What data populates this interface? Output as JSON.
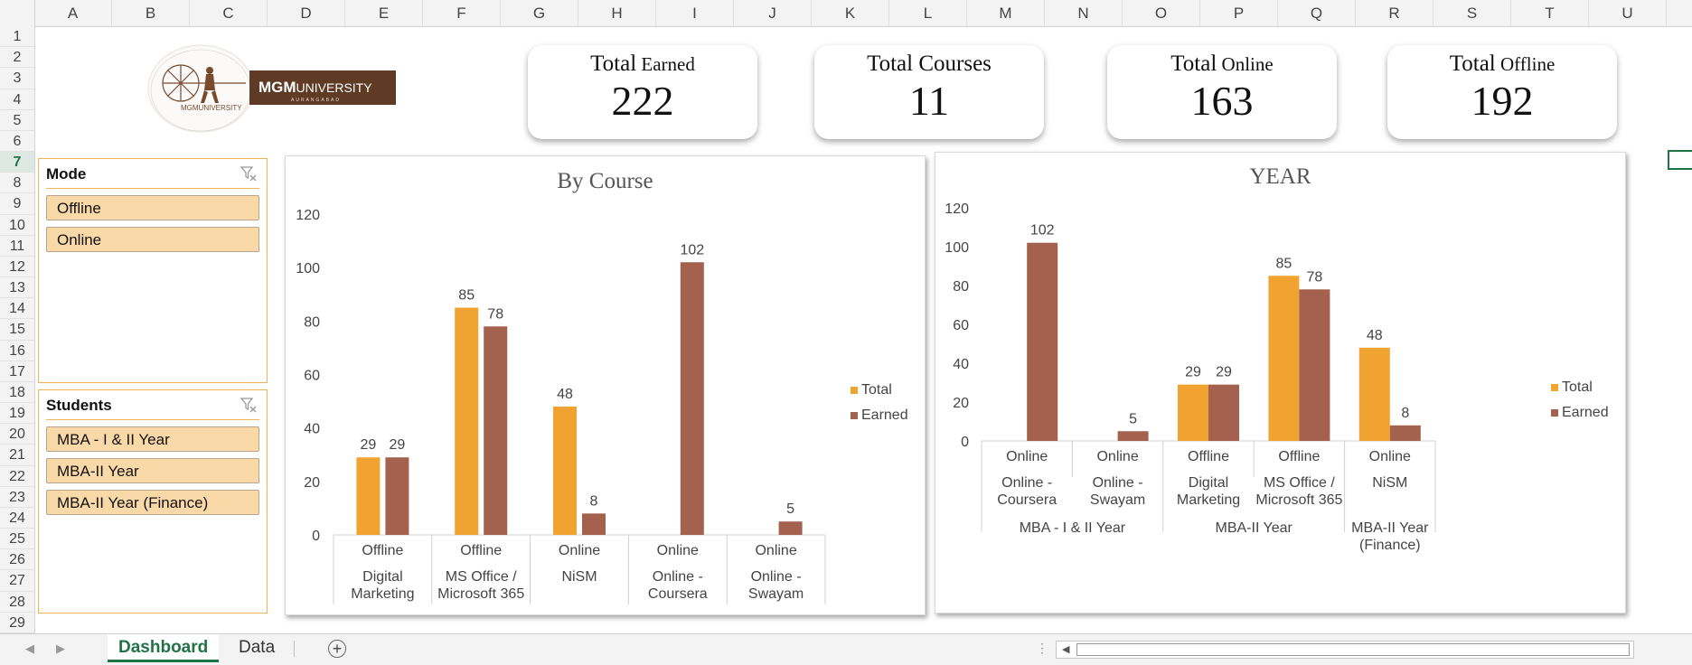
{
  "spreadsheet": {
    "columns": [
      "A",
      "B",
      "C",
      "D",
      "E",
      "F",
      "G",
      "H",
      "I",
      "J",
      "K",
      "L",
      "M",
      "N",
      "O",
      "P",
      "Q",
      "R",
      "S",
      "T",
      "U"
    ],
    "rows": [
      "1",
      "2",
      "3",
      "4",
      "5",
      "6",
      "7",
      "8",
      "9",
      "10",
      "11",
      "12",
      "13",
      "14",
      "15",
      "16",
      "17",
      "18",
      "19",
      "20",
      "21",
      "22",
      "23",
      "24",
      "25",
      "26",
      "27",
      "28",
      "29"
    ],
    "active_row": "7"
  },
  "logo": {
    "brand_bold": "MGM",
    "brand_rest": "UNIVERSITY",
    "city": "AURANGABAD",
    "seal_text": "MGMUNIVERSITY"
  },
  "kpis": [
    {
      "title_main": "Total",
      "title_rest": " Earned",
      "value": "222"
    },
    {
      "title_main": "Total Courses",
      "title_rest": "",
      "value": "11"
    },
    {
      "title_main": "Total",
      "title_rest": " Online",
      "value": "163"
    },
    {
      "title_main": "Total",
      "title_rest": " Offline",
      "value": "192"
    }
  ],
  "slicers": {
    "mode": {
      "title": "Mode",
      "items": [
        "Offline",
        "Online"
      ]
    },
    "students": {
      "title": "Students",
      "items": [
        "MBA - I & II Year",
        "MBA-II Year",
        "MBA-II Year (Finance)"
      ]
    }
  },
  "colors": {
    "total": "#f0a330",
    "earned": "#a3614e",
    "accent": "#217346"
  },
  "chart_data": [
    {
      "type": "bar",
      "title": "By Course",
      "categories": [
        {
          "mode": "Offline",
          "course": [
            "Digital",
            "Marketing"
          ]
        },
        {
          "mode": "Offline",
          "course": [
            "MS Office /",
            "Microsoft 365"
          ]
        },
        {
          "mode": "Online",
          "course": [
            "NiSM"
          ]
        },
        {
          "mode": "Online",
          "course": [
            "Online -",
            "Coursera"
          ]
        },
        {
          "mode": "Online",
          "course": [
            "Online -",
            "Swayam"
          ]
        }
      ],
      "series": [
        {
          "name": "Total",
          "values": [
            29,
            85,
            48,
            null,
            null
          ]
        },
        {
          "name": "Earned",
          "values": [
            29,
            78,
            8,
            102,
            5
          ]
        }
      ],
      "ylim": [
        0,
        120
      ],
      "yticks": [
        0,
        20,
        40,
        60,
        80,
        100,
        120
      ],
      "legend": "right",
      "grid": false
    },
    {
      "type": "bar",
      "title": "YEAR",
      "categories": [
        {
          "mode": "Online",
          "course": [
            "Online -",
            "Coursera"
          ]
        },
        {
          "mode": "Online",
          "course": [
            "Online -",
            "Swayam"
          ]
        },
        {
          "mode": "Offline",
          "course": [
            "Digital",
            "Marketing"
          ]
        },
        {
          "mode": "Offline",
          "course": [
            "MS Office /",
            "Microsoft 365"
          ]
        },
        {
          "mode": "Online",
          "course": [
            "NiSM"
          ]
        }
      ],
      "groups": [
        {
          "label": [
            "MBA - I & II Year"
          ],
          "span": 2
        },
        {
          "label": [
            "MBA-II Year"
          ],
          "span": 2
        },
        {
          "label": [
            "MBA-II Year",
            "(Finance)"
          ],
          "span": 1
        }
      ],
      "series": [
        {
          "name": "Total",
          "values": [
            null,
            null,
            29,
            85,
            48
          ]
        },
        {
          "name": "Earned",
          "values": [
            102,
            5,
            29,
            78,
            8
          ]
        }
      ],
      "ylim": [
        0,
        120
      ],
      "yticks": [
        0,
        20,
        40,
        60,
        80,
        100,
        120
      ],
      "legend": "right",
      "grid": false
    }
  ],
  "tabs": {
    "sheets": [
      {
        "label": "Dashboard",
        "active": true
      },
      {
        "label": "Data",
        "active": false
      }
    ],
    "add_label": "+"
  }
}
